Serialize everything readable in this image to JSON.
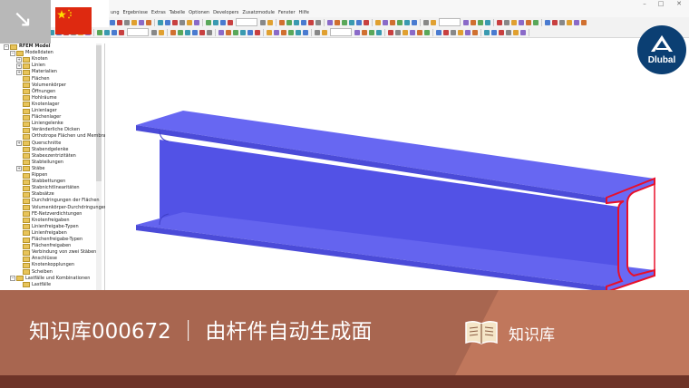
{
  "window": {
    "minimize": "–",
    "maximize": "□",
    "close": "✕"
  },
  "menu": [
    "ung",
    "Ergebnisse",
    "Extras",
    "Tabelle",
    "Optionen",
    "Developers",
    "Zusatzmodule",
    "Fenster",
    "Hilfe"
  ],
  "navigator": {
    "rows": [
      {
        "label": "RFEM Model",
        "indent": 0,
        "expander": "−",
        "bold": true
      },
      {
        "label": "Modelldaten",
        "indent": 1,
        "expander": "−",
        "bold": false
      },
      {
        "label": "Knoten",
        "indent": 2,
        "expander": "+",
        "bold": false
      },
      {
        "label": "Linien",
        "indent": 2,
        "expander": "+",
        "bold": false
      },
      {
        "label": "Materialien",
        "indent": 2,
        "expander": "+",
        "bold": false
      },
      {
        "label": "Flächen",
        "indent": 2,
        "expander": "",
        "bold": false
      },
      {
        "label": "Volumenkörper",
        "indent": 2,
        "expander": "",
        "bold": false
      },
      {
        "label": "Öffnungen",
        "indent": 2,
        "expander": "",
        "bold": false
      },
      {
        "label": "Hohlräume",
        "indent": 2,
        "expander": "",
        "bold": false
      },
      {
        "label": "Knotenlager",
        "indent": 2,
        "expander": "",
        "bold": false
      },
      {
        "label": "Linienlager",
        "indent": 2,
        "expander": "",
        "bold": false
      },
      {
        "label": "Flächenlager",
        "indent": 2,
        "expander": "",
        "bold": false
      },
      {
        "label": "Liniengelenke",
        "indent": 2,
        "expander": "",
        "bold": false
      },
      {
        "label": "Veränderliche Dicken",
        "indent": 2,
        "expander": "",
        "bold": false
      },
      {
        "label": "Orthotrope Flächen und Membran",
        "indent": 2,
        "expander": "",
        "bold": false
      },
      {
        "label": "Querschnitte",
        "indent": 2,
        "expander": "+",
        "bold": false
      },
      {
        "label": "Stabendgelenke",
        "indent": 2,
        "expander": "",
        "bold": false
      },
      {
        "label": "Stabexzentrizitäten",
        "indent": 2,
        "expander": "",
        "bold": false
      },
      {
        "label": "Stabteilungen",
        "indent": 2,
        "expander": "",
        "bold": false
      },
      {
        "label": "Stäbe",
        "indent": 2,
        "expander": "+",
        "bold": false
      },
      {
        "label": "Rippen",
        "indent": 2,
        "expander": "",
        "bold": false
      },
      {
        "label": "Stabbettungen",
        "indent": 2,
        "expander": "",
        "bold": false
      },
      {
        "label": "Stabnichtlinearitäten",
        "indent": 2,
        "expander": "",
        "bold": false
      },
      {
        "label": "Stabsätze",
        "indent": 2,
        "expander": "",
        "bold": false
      },
      {
        "label": "Durchdringungen der Flächen",
        "indent": 2,
        "expander": "",
        "bold": false
      },
      {
        "label": "Volumenkörper-Durchdringungen",
        "indent": 2,
        "expander": "",
        "bold": false
      },
      {
        "label": "FE-Netzverdichtungen",
        "indent": 2,
        "expander": "",
        "bold": false
      },
      {
        "label": "Knotenfreigaben",
        "indent": 2,
        "expander": "",
        "bold": false
      },
      {
        "label": "Linienfreigabe-Typen",
        "indent": 2,
        "expander": "",
        "bold": false
      },
      {
        "label": "Linienfreigaben",
        "indent": 2,
        "expander": "",
        "bold": false
      },
      {
        "label": "Flächenfreigabe-Typen",
        "indent": 2,
        "expander": "",
        "bold": false
      },
      {
        "label": "Flächenfreigaben",
        "indent": 2,
        "expander": "",
        "bold": false
      },
      {
        "label": "Verbindung von zwei Stäben",
        "indent": 2,
        "expander": "",
        "bold": false
      },
      {
        "label": "Anschlüsse",
        "indent": 2,
        "expander": "",
        "bold": false
      },
      {
        "label": "Knotenkopplungen",
        "indent": 2,
        "expander": "",
        "bold": false
      },
      {
        "label": "Scheiben",
        "indent": 2,
        "expander": "",
        "bold": false
      },
      {
        "label": "Lastfälle und Kombinationen",
        "indent": 1,
        "expander": "−",
        "bold": false
      },
      {
        "label": "Lastfälle",
        "indent": 2,
        "expander": "",
        "bold": false
      }
    ]
  },
  "logo": {
    "text": "Dlubal"
  },
  "banner": {
    "title": "知识库000672 ｜ 由杆件自动生成面",
    "kb_label": "知识库"
  },
  "colors": {
    "beam_face": "#5c5cf0",
    "beam_edge": "#e8102a",
    "banner": "#b56f55",
    "logo_bg": "#0b3f73"
  },
  "icons": [
    "arrow-down-right-icon",
    "china-flag-icon",
    "dlubal-logo-icon",
    "book-icon"
  ]
}
